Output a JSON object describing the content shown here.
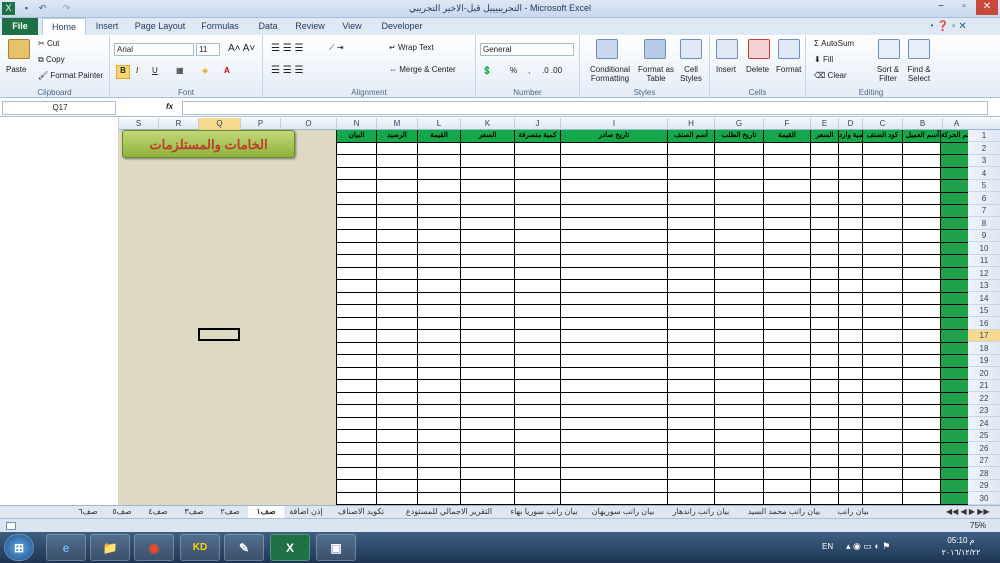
{
  "window": {
    "title": "التجريبيييل قبل-الاخير التجريبي - Microsoft Excel",
    "controls": [
      "−",
      "▫",
      "✕"
    ]
  },
  "ribbon_tabs": [
    "File",
    "Home",
    "Insert",
    "Page Layout",
    "Formulas",
    "Data",
    "Review",
    "View",
    "Developer"
  ],
  "clipboard": {
    "paste": "Paste",
    "cut": "Cut",
    "copy": "Copy",
    "format_painter": "Format Painter",
    "label": "Clipboard"
  },
  "font": {
    "name": "Arial",
    "size": "11",
    "bold": "B",
    "italic": "I",
    "underline": "U",
    "label": "Font"
  },
  "alignment": {
    "wrap": "Wrap Text",
    "merge": "Merge & Center",
    "label": "Alignment"
  },
  "number": {
    "format": "General",
    "label": "Number",
    "pct": "%",
    "comma": ","
  },
  "styles": {
    "cond": "Conditional Formatting",
    "table": "Format as Table",
    "cell": "Cell Styles",
    "label": "Styles"
  },
  "cells": {
    "insert": "Insert",
    "delete": "Delete",
    "format": "Format",
    "label": "Cells"
  },
  "editing": {
    "autosum": "AutoSum",
    "fill": "Fill",
    "clear": "Clear",
    "sort": "Sort & Filter",
    "find": "Find & Select",
    "label": "Editing"
  },
  "formula_bar": {
    "name_box": "Q17",
    "fx": "fx",
    "value": ""
  },
  "columns_left": [
    "S",
    "R",
    "Q",
    "P",
    "O"
  ],
  "grid_columns": [
    {
      "letter": "N",
      "header": "البيان"
    },
    {
      "letter": "M",
      "header": "الرصيد"
    },
    {
      "letter": "L",
      "header": "القيمة"
    },
    {
      "letter": "K",
      "header": "السعر"
    },
    {
      "letter": "J",
      "header": "كمية منصرفة"
    },
    {
      "letter": "I",
      "header": "تاريخ صادر"
    },
    {
      "letter": "H",
      "header": "أسم الصنف"
    },
    {
      "letter": "G",
      "header": "تاريخ الطلب"
    },
    {
      "letter": "F",
      "header": "القيمة"
    },
    {
      "letter": "E",
      "header": "السعر"
    },
    {
      "letter": "D",
      "header": "كمية وارد"
    },
    {
      "letter": "C",
      "header": "كود الصنف"
    },
    {
      "letter": "B",
      "header": "أسم العميل"
    },
    {
      "letter": "A",
      "header": "رقم الحركة"
    }
  ],
  "rows": [
    "1",
    "2",
    "3",
    "4",
    "5",
    "6",
    "7",
    "8",
    "9",
    "10",
    "11",
    "12",
    "13",
    "14",
    "15",
    "16",
    "17",
    "18",
    "19",
    "20",
    "21",
    "22",
    "23",
    "24",
    "25",
    "26",
    "27",
    "28",
    "29",
    "30"
  ],
  "sheet_title": "الخامات والمستلزمات",
  "sheet_tabs": [
    "صف٦",
    "صف٥",
    "صف٤",
    "صف٣",
    "صف٢",
    "صف١",
    "إذن اضافة",
    "تكويد الاصناف",
    "التقرير الاجمالي للمستودع",
    "بيان راتب سوريا بهاء",
    "بيان راتب سوريهان",
    "بيان راتب راندهار",
    "بيان راتب محمد السيد",
    "بيان راتب"
  ],
  "status": {
    "zoom": "75%"
  },
  "taskbar": {
    "lang": "EN",
    "time": "05:10 م",
    "date": "٢٠١٦/١٢/٢٢",
    "apps": [
      "⊞",
      "e",
      "📁",
      "◉",
      "KD",
      "✎",
      "X",
      "▣"
    ]
  },
  "colors": {
    "green": "#1fa24a",
    "tan": "#ddd9c3",
    "excel": "#1e7145"
  }
}
